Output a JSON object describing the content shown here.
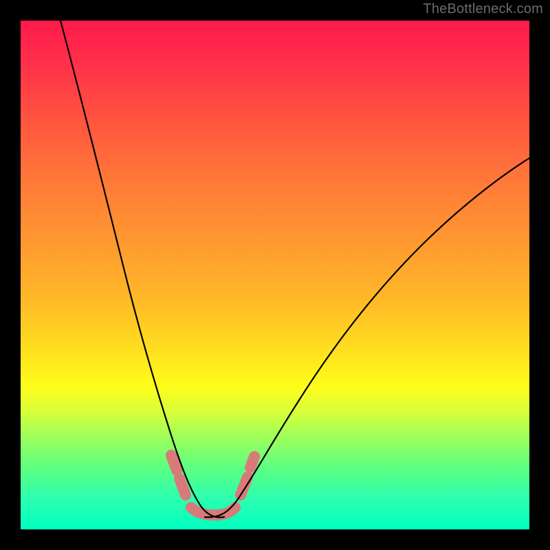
{
  "watermark": "TheBottleneck.com",
  "colors": {
    "frame": "#000000",
    "gradient_top": "#ff1a4a",
    "gradient_mid": "#ffe01e",
    "gradient_bottom": "#00ffc0",
    "curve": "#000000",
    "marker": "#d97a7a"
  },
  "chart_data": {
    "type": "line",
    "title": "",
    "xlabel": "",
    "ylabel": "",
    "xlim": [
      0,
      100
    ],
    "ylim": [
      0,
      100
    ],
    "x": [
      0,
      5,
      10,
      15,
      20,
      25,
      28,
      30,
      32,
      34,
      36,
      38,
      40,
      45,
      50,
      55,
      60,
      65,
      70,
      75,
      80,
      85,
      90,
      95,
      100
    ],
    "values": [
      100,
      85,
      70,
      55,
      40,
      26,
      16,
      10,
      5,
      2,
      0,
      0,
      2,
      8,
      15,
      22,
      29,
      35,
      41,
      47,
      52,
      57,
      61,
      65,
      69
    ],
    "minimum_x": 36,
    "minimum_value": 0,
    "markers_x": [
      30,
      32,
      34,
      36,
      38,
      40,
      43,
      45
    ],
    "markers_y": [
      10,
      5,
      2,
      0,
      0,
      2,
      6,
      8
    ],
    "note": "Values are visual estimates read from pixel positions on an unlabeled gradient chart; y=0 at bottom, y=100 at top."
  }
}
